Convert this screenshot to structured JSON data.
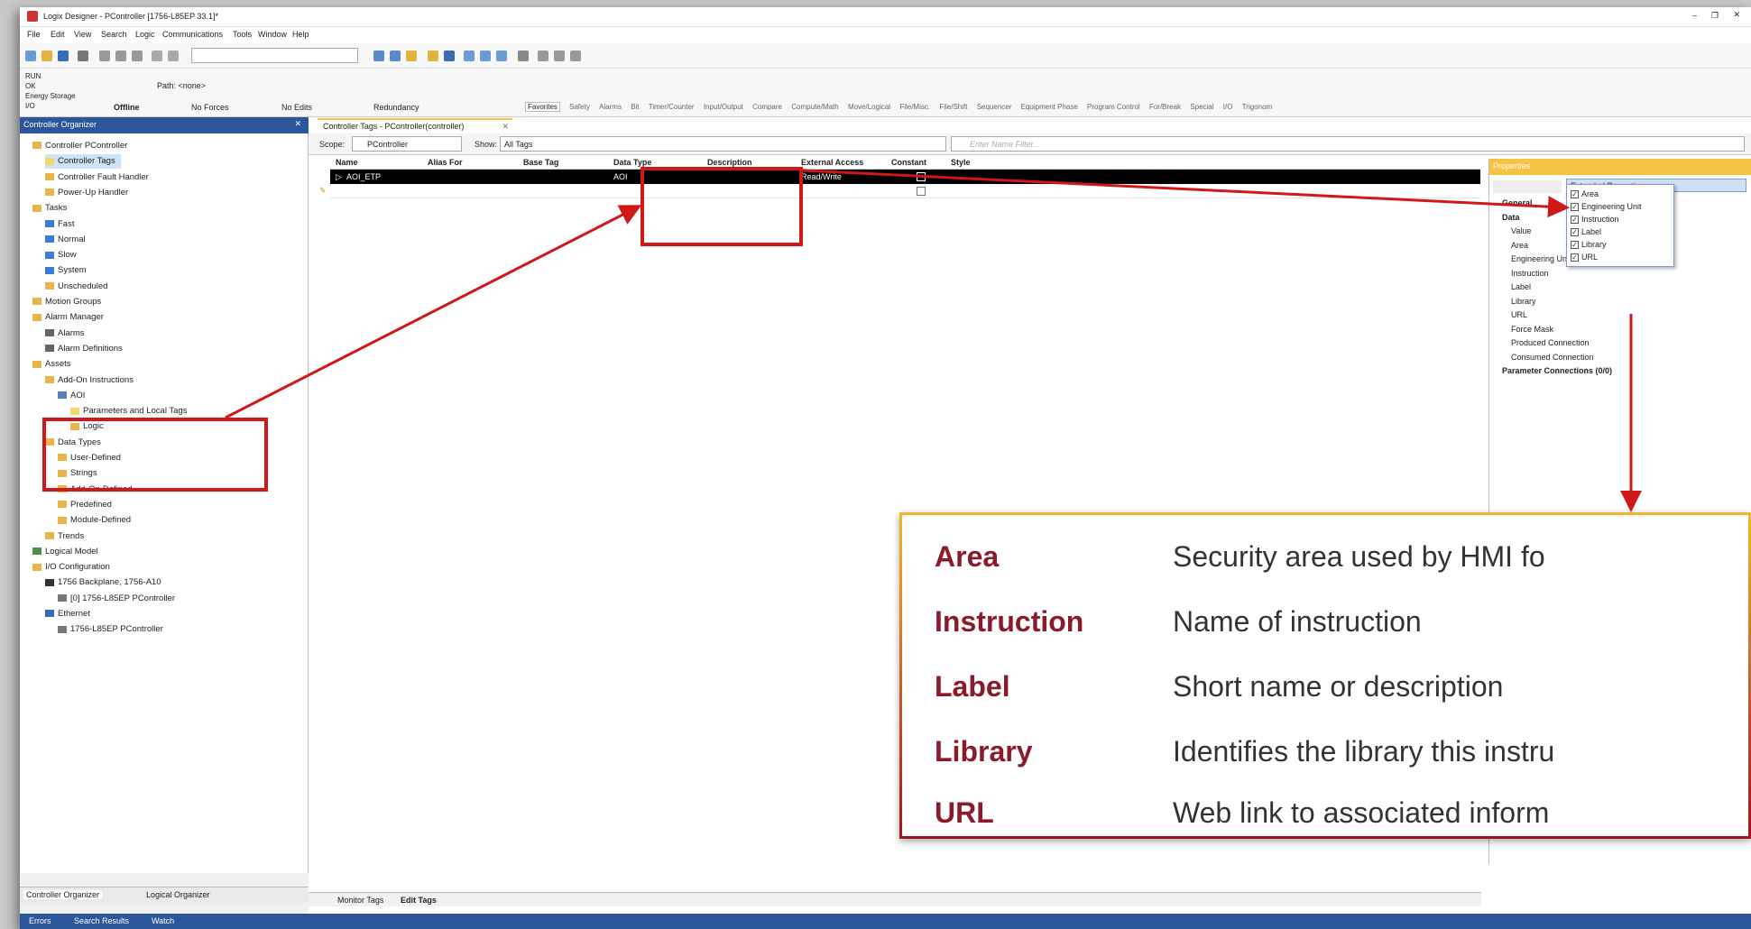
{
  "window": {
    "title": "Logix Designer - PController [1756-L85EP 33.1]*"
  },
  "menu": [
    "File",
    "Edit",
    "View",
    "Search",
    "Logic",
    "Communications",
    "Tools",
    "Window",
    "Help"
  ],
  "status": {
    "run": "RUN",
    "ok": "OK",
    "energy": "Energy Storage",
    "io": "I/O",
    "path": "Path: <none>",
    "mode": "Offline",
    "forces": "No Forces",
    "edits": "No Edits",
    "redundancy": "Redundancy"
  },
  "instruction_tabs": [
    "Favorites",
    "Safety",
    "Alarms",
    "Bit",
    "Timer/Counter",
    "Input/Output",
    "Compare",
    "Compute/Math",
    "Move/Logical",
    "File/Misc.",
    "File/Shift",
    "Sequencer",
    "Equipment Phase",
    "Program Control",
    "For/Break",
    "Special",
    "I/O",
    "Trigonom"
  ],
  "organizer": {
    "header": "Controller Organizer",
    "tree": [
      {
        "label": "Controller PController",
        "indent": 0,
        "icon": "folder"
      },
      {
        "label": "Controller Tags",
        "indent": 1,
        "icon": "tag",
        "selected": true
      },
      {
        "label": "Controller Fault Handler",
        "indent": 1,
        "icon": "folder"
      },
      {
        "label": "Power-Up Handler",
        "indent": 1,
        "icon": "folder"
      },
      {
        "label": "Tasks",
        "indent": 0,
        "icon": "folder"
      },
      {
        "label": "Fast",
        "indent": 1,
        "icon": "clock"
      },
      {
        "label": "Normal",
        "indent": 1,
        "icon": "clock"
      },
      {
        "label": "Slow",
        "indent": 1,
        "icon": "clock"
      },
      {
        "label": "System",
        "indent": 1,
        "icon": "clock"
      },
      {
        "label": "Unscheduled",
        "indent": 1,
        "icon": "folder"
      },
      {
        "label": "Motion Groups",
        "indent": 0,
        "icon": "folder"
      },
      {
        "label": "Alarm Manager",
        "indent": 0,
        "icon": "folder"
      },
      {
        "label": "Alarms",
        "indent": 1,
        "icon": "bell"
      },
      {
        "label": "Alarm Definitions",
        "indent": 1,
        "icon": "bell"
      },
      {
        "label": "Assets",
        "indent": 0,
        "icon": "folder"
      },
      {
        "label": "Add-On Instructions",
        "indent": 1,
        "icon": "folder"
      },
      {
        "label": "AOI",
        "indent": 2,
        "icon": "aoi"
      },
      {
        "label": "Parameters and Local Tags",
        "indent": 3,
        "icon": "tag"
      },
      {
        "label": "Logic",
        "indent": 3,
        "icon": "folder"
      },
      {
        "label": "Data Types",
        "indent": 1,
        "icon": "folder"
      },
      {
        "label": "User-Defined",
        "indent": 2,
        "icon": "folder"
      },
      {
        "label": "Strings",
        "indent": 2,
        "icon": "folder"
      },
      {
        "label": "Add-On-Defined",
        "indent": 2,
        "icon": "folder"
      },
      {
        "label": "Predefined",
        "indent": 2,
        "icon": "folder"
      },
      {
        "label": "Module-Defined",
        "indent": 2,
        "icon": "folder"
      },
      {
        "label": "Trends",
        "indent": 1,
        "icon": "folder"
      },
      {
        "label": "Logical Model",
        "indent": 0,
        "icon": "model"
      },
      {
        "label": "I/O Configuration",
        "indent": 0,
        "icon": "folder"
      },
      {
        "label": "1756 Backplane, 1756-A10",
        "indent": 1,
        "icon": "rack"
      },
      {
        "label": "[0] 1756-L85EP PController",
        "indent": 2,
        "icon": "module"
      },
      {
        "label": "Ethernet",
        "indent": 1,
        "icon": "net"
      },
      {
        "label": "1756-L85EP PController",
        "indent": 2,
        "icon": "module"
      }
    ]
  },
  "bottom_tabs": [
    "Controller Organizer",
    "Logical Organizer"
  ],
  "editor": {
    "tab_label": "Controller Tags - PController(controller)",
    "scope_label": "Scope:",
    "scope_value": "PController",
    "show_label": "Show:",
    "show_value": "All Tags",
    "filter_placeholder": "Enter Name Filter...",
    "columns": [
      "Name",
      "Alias For",
      "Base Tag",
      "Data Type",
      "Description",
      "External Access",
      "Constant",
      "Style"
    ],
    "rows": [
      {
        "name": "AOI_ETP",
        "alias": "",
        "base": "",
        "type": "AOI",
        "desc": "",
        "access": "Read/Write",
        "constant": false,
        "style": ""
      }
    ],
    "sheet_tabs": [
      "Monitor Tags",
      "Edit Tags"
    ]
  },
  "properties": {
    "header": "Properties",
    "filter": "Extended Properties...",
    "dropdown": [
      "Area",
      "Engineering Unit",
      "Instruction",
      "Label",
      "Library",
      "URL"
    ],
    "rows": [
      {
        "label": "General",
        "bold": true
      },
      {
        "label": "Data",
        "bold": true
      },
      {
        "label": "Value"
      },
      {
        "label": "Area"
      },
      {
        "label": "Engineering Unit"
      },
      {
        "label": "Instruction"
      },
      {
        "label": "Label"
      },
      {
        "label": "Library"
      },
      {
        "label": "URL"
      },
      {
        "label": "Force Mask"
      },
      {
        "label": "Produced Connection"
      },
      {
        "label": "Consumed Connection"
      },
      {
        "label": "Parameter Connections (0/0)",
        "bold": true
      }
    ]
  },
  "callout": [
    {
      "term": "Area",
      "desc": "Security area used by HMI fo"
    },
    {
      "term": "Instruction",
      "desc": "Name of instruction"
    },
    {
      "term": "Label",
      "desc": "Short name or description"
    },
    {
      "term": "Library",
      "desc": "Identifies the library this instru"
    },
    {
      "term": "URL",
      "desc": "Web link to associated inform"
    }
  ],
  "statusbar": [
    "Errors",
    "Search Results",
    "Watch"
  ],
  "colors": {
    "accent": "#2b579a",
    "highlight": "#d01818",
    "callout_term": "#8b1a2a",
    "tab_gold": "#f5c242"
  }
}
